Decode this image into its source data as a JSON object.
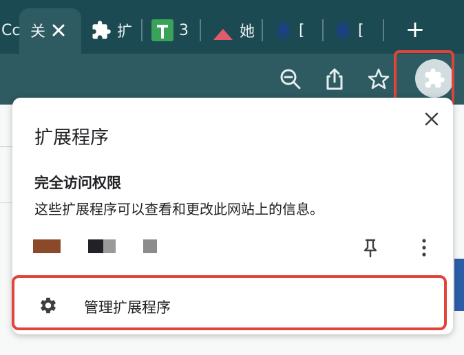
{
  "tabs": [
    {
      "text": "Сс",
      "icon": "partial-tab",
      "active": false
    },
    {
      "text": "关",
      "icon": "close-icon",
      "active": true
    },
    {
      "text": "扩",
      "icon": "puzzle-icon",
      "active": false
    },
    {
      "text": "3",
      "icon": "plus-favicon",
      "active": false
    },
    {
      "text": "她",
      "icon": "triangle-favicon",
      "active": false
    },
    {
      "text": "[",
      "icon": "figure-favicon",
      "active": false
    },
    {
      "text": "[",
      "icon": "figure-favicon",
      "active": false
    }
  ],
  "popup": {
    "title": "扩展程序",
    "perm_title": "完全访问权限",
    "perm_desc": "这些扩展程序可以查看和更改此网站上的信息。",
    "manage_label": "管理扩展程序"
  },
  "colors": {
    "tabstrip": "#1b4a52",
    "toolbar": "#2e5a62",
    "highlight": "#e0443a",
    "ext_swatch_1": "#8a4a2a",
    "ext_swatch_2": "#222226",
    "ext_swatch_3": "#8c8c8c"
  },
  "icons": [
    "zoom-out-icon",
    "share-icon",
    "star-icon",
    "puzzle-icon",
    "close-icon",
    "pin-icon",
    "more-vert-icon",
    "gear-icon"
  ]
}
